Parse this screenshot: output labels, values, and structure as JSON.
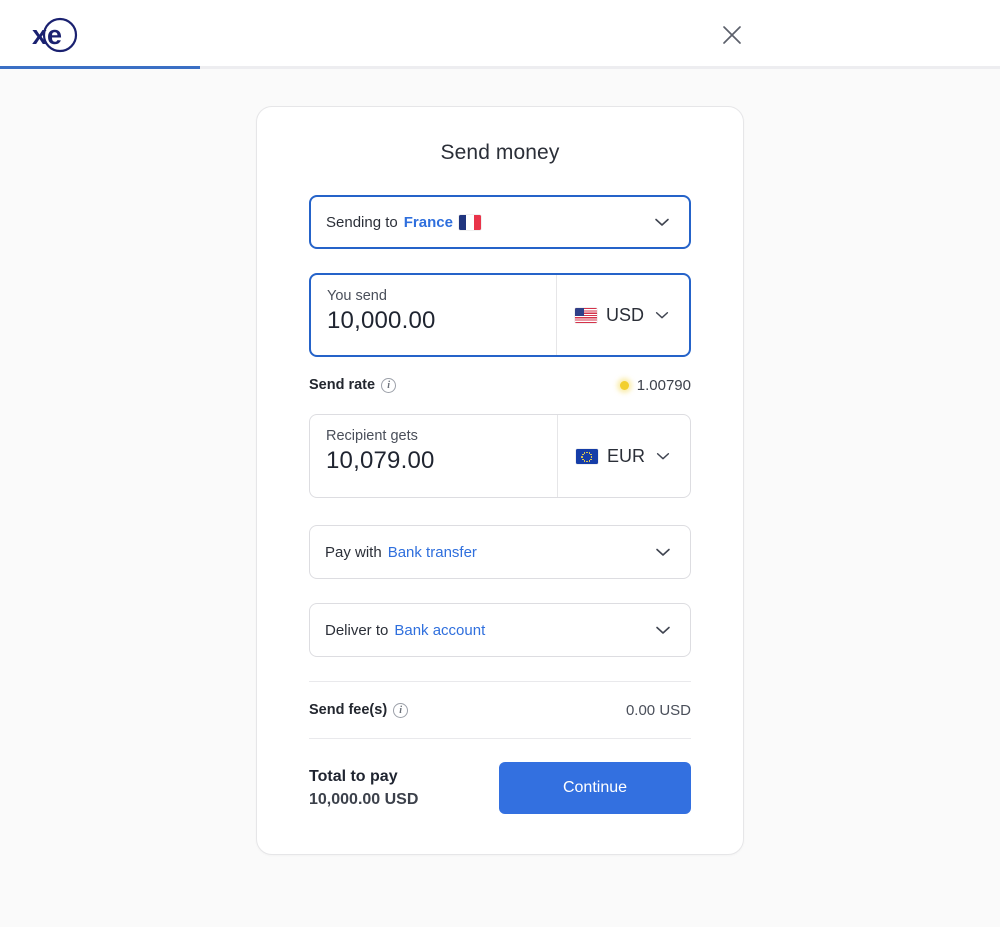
{
  "header": {
    "logo_text": "xe",
    "close_icon": "close-icon",
    "progress_percent": 20
  },
  "card": {
    "title": "Send money",
    "destination": {
      "prefix": "Sending to",
      "country": "France",
      "flag": "flag-france",
      "chevron": "chevron-down-icon"
    },
    "you_send": {
      "caption": "You send",
      "amount": "10,000.00",
      "currency": "USD",
      "flag": "flag-usa",
      "chevron": "chevron-down-icon"
    },
    "send_rate": {
      "label": "Send rate",
      "info_icon": "info-icon",
      "live_indicator": "live-rate-dot",
      "value": "1.00790"
    },
    "recipient_gets": {
      "caption": "Recipient gets",
      "amount": "10,079.00",
      "currency": "EUR",
      "flag": "flag-eu",
      "chevron": "chevron-down-icon"
    },
    "pay_with": {
      "prefix": "Pay with",
      "value": "Bank transfer",
      "chevron": "chevron-down-icon"
    },
    "deliver_to": {
      "prefix": "Deliver to",
      "value": "Bank account",
      "chevron": "chevron-down-icon"
    },
    "send_fees": {
      "label": "Send fee(s)",
      "info_icon": "info-icon",
      "value": "0.00 USD"
    },
    "total": {
      "label": "Total to pay",
      "amount": "10,000.00 USD",
      "cta_label": "Continue"
    }
  },
  "colors": {
    "accent_blue": "#2f6fdd",
    "button_blue": "#3370e0",
    "progress_blue": "#3a6fc4",
    "logo_navy": "#1a2170",
    "live_yellow": "#f2cf2e"
  }
}
